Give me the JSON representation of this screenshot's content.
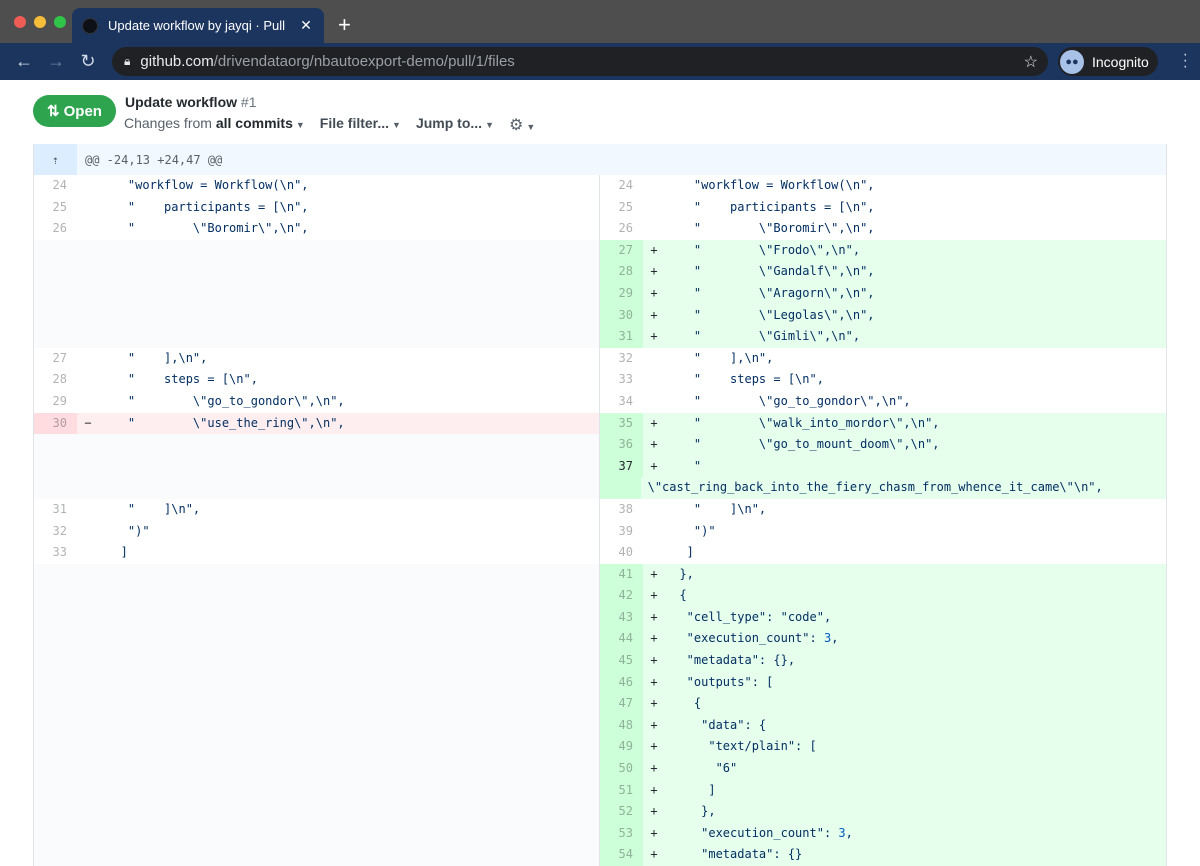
{
  "browser": {
    "tab_title": "Update workflow by jayqi · Pull",
    "tab_close": "✕",
    "new_tab": "+",
    "url_host": "github.com",
    "url_path": "/drivendataorg/nbautoexport-demo/pull/1/files",
    "profile_label": "Incognito"
  },
  "pr": {
    "state": "Open",
    "title": "Update workflow",
    "number": "#1",
    "changes_prefix": "Changes from ",
    "changes_value": "all commits",
    "file_filter": "File filter...",
    "jump_to": "Jump to..."
  },
  "diff": {
    "hunk_header": "@@ -24,13 +24,47 @@",
    "rows": [
      {
        "l": {
          "n": "24",
          "t": "ctx",
          "c": "    \"workflow = Workflow(\\n\","
        },
        "r": {
          "n": "24",
          "t": "ctx",
          "c": "    \"workflow = Workflow(\\n\","
        }
      },
      {
        "l": {
          "n": "25",
          "t": "ctx",
          "c": "    \"    participants = [\\n\","
        },
        "r": {
          "n": "25",
          "t": "ctx",
          "c": "    \"    participants = [\\n\","
        }
      },
      {
        "l": {
          "n": "26",
          "t": "ctx",
          "c": "    \"        \\\"Boromir\\\",\\n\","
        },
        "r": {
          "n": "26",
          "t": "ctx",
          "c": "    \"        \\\"Boromir\\\",\\n\","
        }
      },
      {
        "l": {
          "t": "empty"
        },
        "r": {
          "n": "27",
          "t": "add",
          "c": "    \"        \\\"Frodo\\\",\\n\","
        }
      },
      {
        "l": {
          "t": "empty"
        },
        "r": {
          "n": "28",
          "t": "add",
          "c": "    \"        \\\"Gandalf\\\",\\n\","
        }
      },
      {
        "l": {
          "t": "empty"
        },
        "r": {
          "n": "29",
          "t": "add",
          "c": "    \"        \\\"Aragorn\\\",\\n\","
        }
      },
      {
        "l": {
          "t": "empty"
        },
        "r": {
          "n": "30",
          "t": "add",
          "c": "    \"        \\\"Legolas\\\",\\n\","
        }
      },
      {
        "l": {
          "t": "empty"
        },
        "r": {
          "n": "31",
          "t": "add",
          "c": "    \"        \\\"Gimli\\\",\\n\","
        }
      },
      {
        "l": {
          "n": "27",
          "t": "ctx",
          "c": "    \"    ],\\n\","
        },
        "r": {
          "n": "32",
          "t": "ctx",
          "c": "    \"    ],\\n\","
        }
      },
      {
        "l": {
          "n": "28",
          "t": "ctx",
          "c": "    \"    steps = [\\n\","
        },
        "r": {
          "n": "33",
          "t": "ctx",
          "c": "    \"    steps = [\\n\","
        }
      },
      {
        "l": {
          "n": "29",
          "t": "ctx",
          "c": "    \"        \\\"go_to_gondor\\\",\\n\","
        },
        "r": {
          "n": "34",
          "t": "ctx",
          "c": "    \"        \\\"go_to_gondor\\\",\\n\","
        }
      },
      {
        "l": {
          "n": "30",
          "t": "del",
          "c": "    \"        \\\"use_the_ring\\\",\\n\","
        },
        "r": {
          "n": "35",
          "t": "add",
          "c": "    \"        \\\"walk_into_mordor\\\",\\n\","
        }
      },
      {
        "l": {
          "t": "empty"
        },
        "r": {
          "n": "36",
          "t": "add",
          "c": "    \"        \\\"go_to_mount_doom\\\",\\n\","
        }
      },
      {
        "l": {
          "t": "empty"
        },
        "r": {
          "n": "37",
          "t": "add",
          "tall": true,
          "c": "    \"\n\\\"cast_ring_back_into_the_fiery_chasm_from_whence_it_came\\\"\\n\","
        }
      },
      {
        "l": {
          "n": "31",
          "t": "ctx",
          "c": "    \"    ]\\n\","
        },
        "r": {
          "n": "38",
          "t": "ctx",
          "c": "    \"    ]\\n\","
        }
      },
      {
        "l": {
          "n": "32",
          "t": "ctx",
          "c": "    \")\""
        },
        "r": {
          "n": "39",
          "t": "ctx",
          "c": "    \")\""
        }
      },
      {
        "l": {
          "n": "33",
          "t": "ctx",
          "c": "   ]"
        },
        "r": {
          "n": "40",
          "t": "ctx",
          "c": "   ]"
        }
      },
      {
        "l": {
          "t": "empty"
        },
        "r": {
          "n": "41",
          "t": "add",
          "c": "  },"
        }
      },
      {
        "l": {
          "t": "empty"
        },
        "r": {
          "n": "42",
          "t": "add",
          "c": "  {"
        }
      },
      {
        "l": {
          "t": "empty"
        },
        "r": {
          "n": "43",
          "t": "add",
          "c": "   \"cell_type\": \"code\","
        }
      },
      {
        "l": {
          "t": "empty"
        },
        "r": {
          "n": "44",
          "t": "add",
          "c": "   \"execution_count\": 3,"
        }
      },
      {
        "l": {
          "t": "empty"
        },
        "r": {
          "n": "45",
          "t": "add",
          "c": "   \"metadata\": {},"
        }
      },
      {
        "l": {
          "t": "empty"
        },
        "r": {
          "n": "46",
          "t": "add",
          "c": "   \"outputs\": ["
        }
      },
      {
        "l": {
          "t": "empty"
        },
        "r": {
          "n": "47",
          "t": "add",
          "c": "    {"
        }
      },
      {
        "l": {
          "t": "empty"
        },
        "r": {
          "n": "48",
          "t": "add",
          "c": "     \"data\": {"
        }
      },
      {
        "l": {
          "t": "empty"
        },
        "r": {
          "n": "49",
          "t": "add",
          "c": "      \"text/plain\": ["
        }
      },
      {
        "l": {
          "t": "empty"
        },
        "r": {
          "n": "50",
          "t": "add",
          "c": "       \"6\""
        }
      },
      {
        "l": {
          "t": "empty"
        },
        "r": {
          "n": "51",
          "t": "add",
          "c": "      ]"
        }
      },
      {
        "l": {
          "t": "empty"
        },
        "r": {
          "n": "52",
          "t": "add",
          "c": "     },"
        }
      },
      {
        "l": {
          "t": "empty"
        },
        "r": {
          "n": "53",
          "t": "add",
          "c": "     \"execution_count\": 3,"
        }
      },
      {
        "l": {
          "t": "empty"
        },
        "r": {
          "n": "54",
          "t": "add",
          "c": "     \"metadata\": {}"
        }
      }
    ]
  }
}
